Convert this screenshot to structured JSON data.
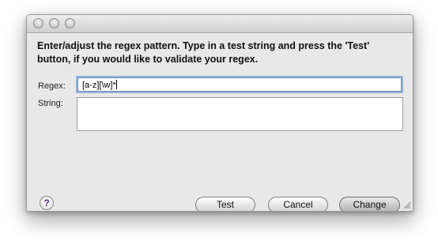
{
  "dialog": {
    "message": "Enter/adjust the regex pattern. Type in a test string and press the 'Test' button, if you would like to validate your regex.",
    "regex_label": "Regex:",
    "regex_value": "[a-z][\\w]*",
    "string_label": "String:",
    "string_value": "",
    "help_glyph": "?",
    "buttons": {
      "test": "Test",
      "cancel": "Cancel",
      "change": "Change"
    }
  }
}
